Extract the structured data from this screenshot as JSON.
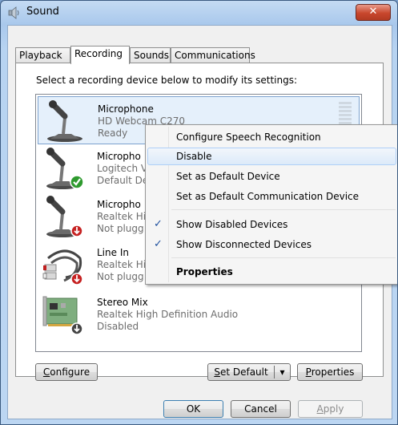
{
  "window": {
    "title": "Sound",
    "close_label": "✕"
  },
  "tabs": [
    "Playback",
    "Recording",
    "Sounds",
    "Communications"
  ],
  "instruction": "Select a recording device below to modify its settings:",
  "devices": [
    {
      "name": "Microphone",
      "line2": "HD Webcam C270",
      "line3": "Ready"
    },
    {
      "name": "Micropho",
      "line2": "Logitech V",
      "line3": "Default De"
    },
    {
      "name": "Micropho",
      "line2": "Realtek Hi",
      "line3": "Not plugg"
    },
    {
      "name": "Line In",
      "line2": "Realtek Hi",
      "line3": "Not plugg"
    },
    {
      "name": "Stereo Mix",
      "line2": "Realtek High Definition Audio",
      "line3": "Disabled"
    }
  ],
  "context_menu": {
    "items": [
      {
        "label": "Configure Speech Recognition",
        "checked": false
      },
      {
        "label": "Disable",
        "checked": false
      },
      {
        "label": "Set as Default Device",
        "checked": false
      },
      {
        "label": "Set as Default Communication Device",
        "checked": false
      },
      {
        "label": "Show Disabled Devices",
        "checked": true
      },
      {
        "label": "Show Disconnected Devices",
        "checked": true
      },
      {
        "label": "Properties",
        "checked": false
      }
    ],
    "highlighted": "Disable",
    "check_glyph": "✓"
  },
  "buttons": {
    "configure_first": "C",
    "configure_rest": "onfigure",
    "set_default_first": "S",
    "set_default_rest": "et Default",
    "set_default_arrow": "▾",
    "properties_first": "P",
    "properties_rest": "roperties",
    "ok": "OK",
    "cancel": "Cancel",
    "apply_first": "A",
    "apply_rest": "pply"
  },
  "colors": {
    "title_bar": "#b7d3f1",
    "close_button": "#c8472d",
    "selection": "#e5f0fb",
    "check_mark": "#1e4f9e"
  }
}
